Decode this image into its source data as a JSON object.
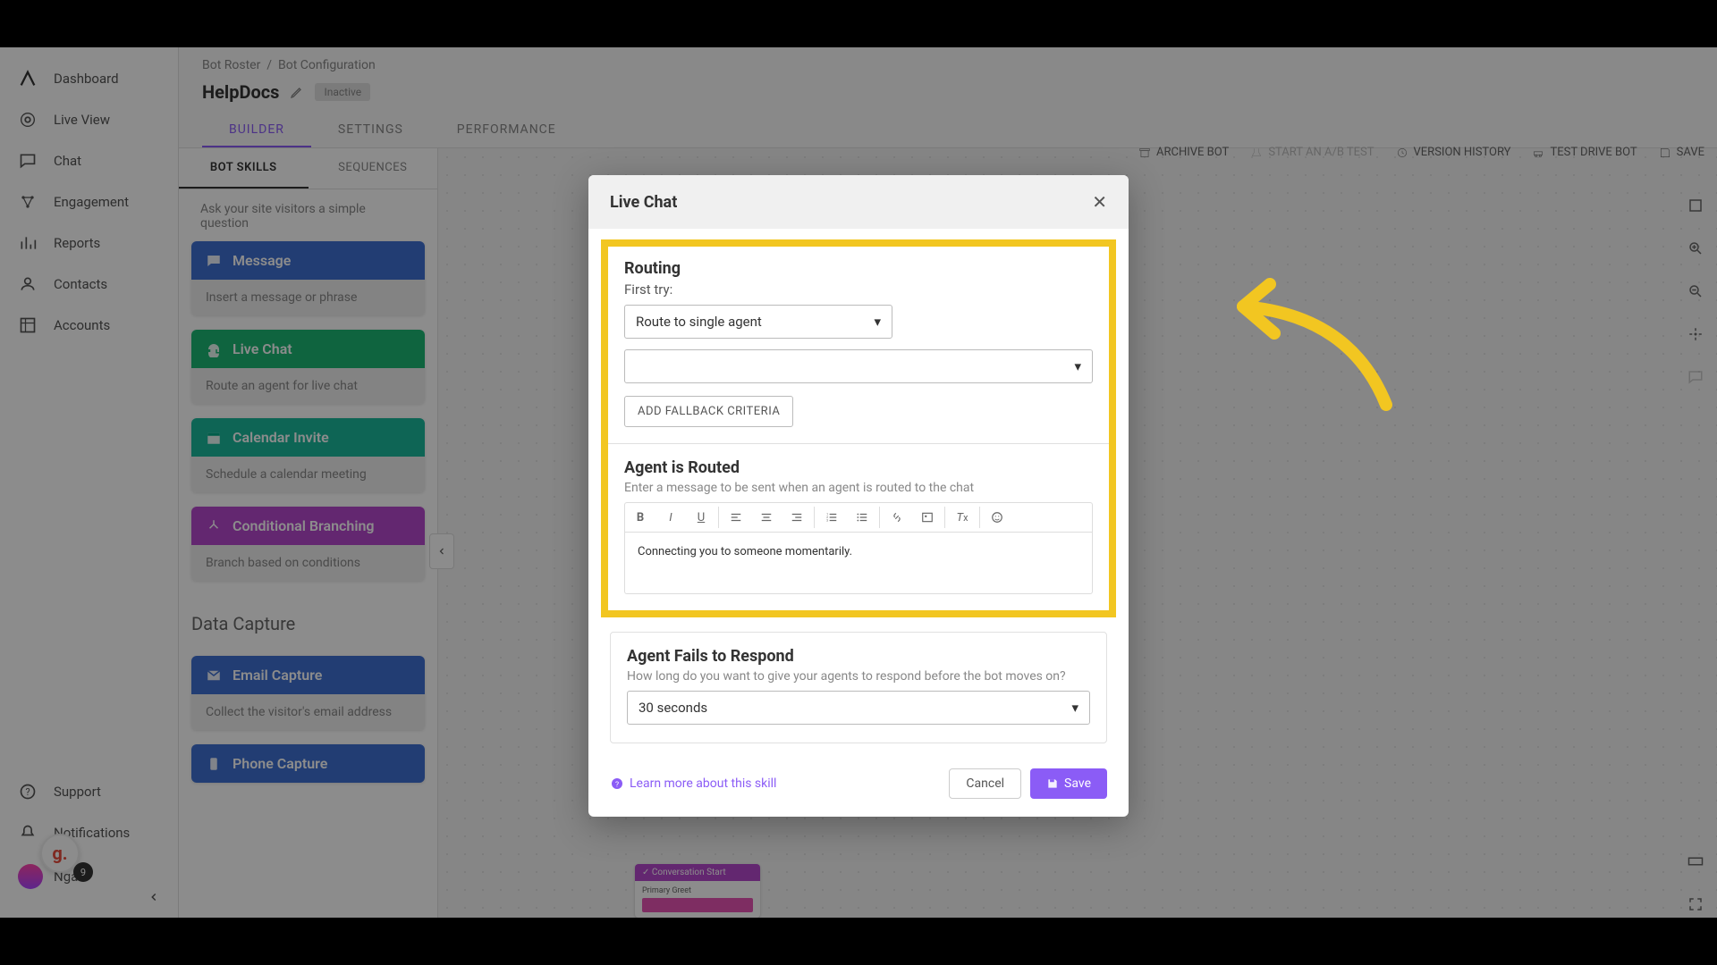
{
  "sidebar": {
    "items": [
      {
        "label": "Dashboard",
        "icon": "dashboard"
      },
      {
        "label": "Live View",
        "icon": "liveview"
      },
      {
        "label": "Chat",
        "icon": "chat"
      },
      {
        "label": "Engagement",
        "icon": "engagement"
      },
      {
        "label": "Reports",
        "icon": "reports"
      },
      {
        "label": "Contacts",
        "icon": "contacts"
      },
      {
        "label": "Accounts",
        "icon": "accounts"
      }
    ],
    "bottom": [
      {
        "label": "Support",
        "icon": "help"
      },
      {
        "label": "Notifications",
        "icon": "bell"
      }
    ],
    "user": {
      "name": "Ngan"
    },
    "badge_g": "g.",
    "badge_count": "9"
  },
  "breadcrumb": {
    "root": "Bot Roster",
    "current": "Bot Configuration"
  },
  "page": {
    "title": "HelpDocs",
    "status": "Inactive"
  },
  "tabs": [
    "BUILDER",
    "SETTINGS",
    "PERFORMANCE"
  ],
  "skills_tabs": [
    "BOT SKILLS",
    "SEQUENCES"
  ],
  "skill_desc": "Ask your site visitors a simple question",
  "skills": [
    {
      "name": "Message",
      "desc": "Insert a message or phrase",
      "color": "blue",
      "icon": "message"
    },
    {
      "name": "Live Chat",
      "desc": "Route an agent for live chat",
      "color": "green",
      "icon": "headset"
    },
    {
      "name": "Calendar Invite",
      "desc": "Schedule a calendar meeting",
      "color": "teal",
      "icon": "calendar"
    },
    {
      "name": "Conditional Branching",
      "desc": "Branch based on conditions",
      "color": "purple",
      "icon": "branch"
    }
  ],
  "data_capture_title": "Data Capture",
  "data_capture": [
    {
      "name": "Email Capture",
      "desc": "Collect the visitor's email address",
      "color": "blue",
      "icon": "email"
    },
    {
      "name": "Phone Capture",
      "desc": "",
      "color": "blue",
      "icon": "phone"
    }
  ],
  "toolbar": {
    "archive": "ARCHIVE BOT",
    "abtest": "START AN A/B TEST",
    "history": "VERSION HISTORY",
    "testdrive": "TEST DRIVE BOT",
    "save": "SAVE"
  },
  "canvas_node": {
    "title": "Conversation Start",
    "sub": "Primary Greet"
  },
  "modal": {
    "title": "Live Chat",
    "routing_heading": "Routing",
    "first_try": "First try:",
    "route_select": "Route to single agent",
    "fallback_btn": "ADD FALLBACK CRITERIA",
    "agent_routed_heading": "Agent is Routed",
    "agent_routed_hint": "Enter a message to be sent when an agent is routed to the chat",
    "rte_content": "Connecting you to someone momentarily.",
    "fails_heading": "Agent Fails to Respond",
    "fails_hint": "How long do you want to give your agents to respond before the bot moves on?",
    "fails_select": "30 seconds",
    "learn_more": "Learn more about this skill",
    "cancel": "Cancel",
    "save": "Save"
  }
}
